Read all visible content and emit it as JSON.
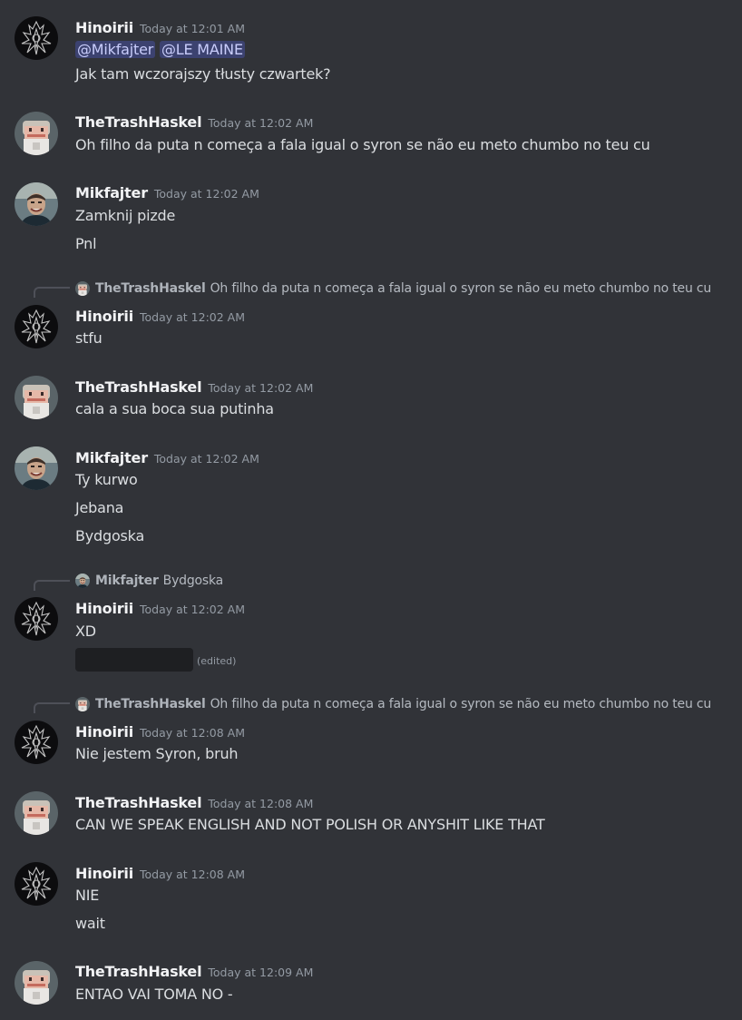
{
  "messages": [
    {
      "author": "Hinoirii",
      "timestamp": "Today at 12:01 AM",
      "mentions": [
        "@Mikfajter",
        "@LE MAINE"
      ],
      "lines": [
        "Jak tam wczorajszy tłusty czwartek?"
      ]
    },
    {
      "author": "TheTrashHaskel",
      "timestamp": "Today at 12:02 AM",
      "lines": [
        "Oh filho da puta n começa a fala igual o syron se não eu meto chumbo no teu cu"
      ]
    },
    {
      "author": "Mikfajter",
      "timestamp": "Today at 12:02 AM",
      "lines": [
        "Zamknij pizde",
        "Pnl"
      ]
    },
    {
      "reply": {
        "author": "TheTrashHaskel",
        "text": "Oh filho da puta n começa a fala igual o syron se não eu meto chumbo no teu cu"
      },
      "author": "Hinoirii",
      "timestamp": "Today at 12:02 AM",
      "lines": [
        "stfu"
      ]
    },
    {
      "author": "TheTrashHaskel",
      "timestamp": "Today at 12:02 AM",
      "lines": [
        "cala a sua boca sua putinha"
      ]
    },
    {
      "author": "Mikfajter",
      "timestamp": "Today at 12:02 AM",
      "lines": [
        "Ty kurwo",
        "Jebana",
        "Bydgoska"
      ]
    },
    {
      "reply": {
        "author": "Mikfajter",
        "text": "Bydgoska"
      },
      "author": "Hinoirii",
      "timestamp": "Today at 12:02 AM",
      "lines": [
        "XD"
      ],
      "edited_label": "(edited)"
    },
    {
      "reply": {
        "author": "TheTrashHaskel",
        "text": "Oh filho da puta n começa a fala igual o syron se não eu meto chumbo no teu cu"
      },
      "author": "Hinoirii",
      "timestamp": "Today at 12:08 AM",
      "lines": [
        "Nie jestem Syron, bruh"
      ]
    },
    {
      "author": "TheTrashHaskel",
      "timestamp": "Today at 12:08 AM",
      "lines": [
        "CAN WE SPEAK ENGLISH AND NOT POLISH OR ANYSHIT LIKE THAT"
      ]
    },
    {
      "author": "Hinoirii",
      "timestamp": "Today at 12:08 AM",
      "lines": [
        "NIE",
        "wait"
      ]
    },
    {
      "author": "TheTrashHaskel",
      "timestamp": "Today at 12:09 AM",
      "lines": [
        "ENTAO VAI TOMA NO -"
      ]
    }
  ],
  "colors": {
    "background": "#313338",
    "username": "#f2f3f5",
    "timestamp": "#949ba4",
    "text": "#dbdee1",
    "mention_bg": "#3c4270",
    "mention_text": "#c9cdfb"
  }
}
